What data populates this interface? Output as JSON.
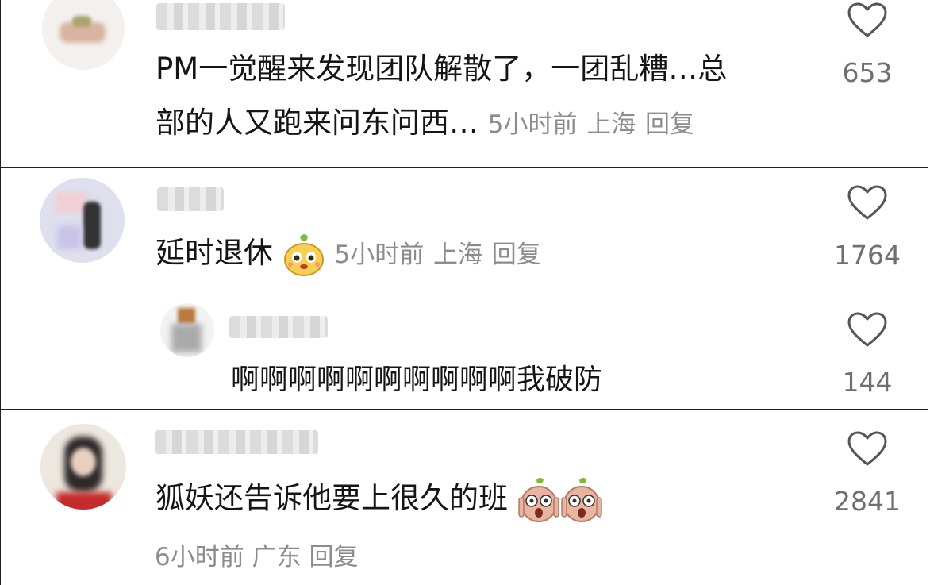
{
  "comments": [
    {
      "text_line1": "PM一觉醒来发现团队解散了，一团乱糟…总",
      "text_line2": "部的人又跑来问东问西…",
      "time": "5小时前",
      "location": "上海",
      "reply": "回复",
      "likes": "653"
    },
    {
      "text": "延时退休",
      "time": "5小时前",
      "location": "上海",
      "reply": "回复",
      "likes": "1764",
      "sub_reply": {
        "text": "啊啊啊啊啊啊啊啊啊啊我破防",
        "likes": "144"
      }
    },
    {
      "text": "狐妖还告诉他要上很久的班",
      "time": "6小时前",
      "location": "广东",
      "reply": "回复",
      "likes": "2841"
    }
  ],
  "icons": {
    "like": "heart-outline-icon",
    "emoji_pear": "pear-face-emoji",
    "emoji_shocked": "shocked-potato-emoji"
  },
  "colors": {
    "text": "#151515",
    "meta": "#8c8c8c",
    "count": "#6f6f6f",
    "divider": "#222222"
  }
}
